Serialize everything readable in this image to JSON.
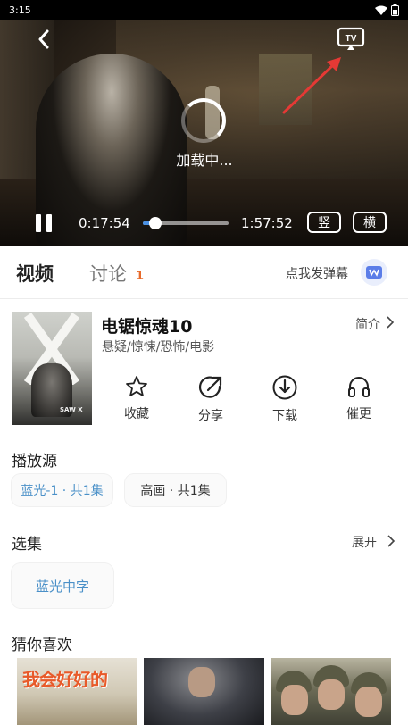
{
  "status_bar": {
    "time": "3:15"
  },
  "player": {
    "loading_text": "加载中...",
    "current_time": "0:17:54",
    "total_time": "1:57:52",
    "progress_fraction": 0.15,
    "portrait_button": "竖",
    "landscape_button": "横",
    "tv_icon_label": "TV"
  },
  "tabs": {
    "video_label": "视频",
    "discuss_label": "讨论",
    "discuss_count": "1",
    "danmu_label": "点我发弹幕"
  },
  "movie": {
    "title": "电锯惊魂10",
    "genres": "悬疑/惊悚/恐怖/电影",
    "intro_label": "简介",
    "poster_text": "SAW X"
  },
  "actions": [
    {
      "label": "收藏",
      "icon": "star-icon"
    },
    {
      "label": "分享",
      "icon": "share-icon"
    },
    {
      "label": "下载",
      "icon": "download-icon"
    },
    {
      "label": "催更",
      "icon": "headphones-icon"
    }
  ],
  "sources": {
    "title": "播放源",
    "items": [
      {
        "label": "蓝光-1 · 共1集",
        "active": true
      },
      {
        "label": "高画 · 共1集",
        "active": false
      }
    ]
  },
  "episodes": {
    "title": "选集",
    "expand_label": "展开",
    "items": [
      {
        "label": "蓝光中字"
      }
    ]
  },
  "recommend": {
    "title": "猜你喜欢",
    "first_card_text": "我会好好的"
  },
  "colors": {
    "accent_blue": "#4a90c8",
    "progress_blue": "#4a90e2",
    "badge_orange": "#e86a2a",
    "annotation_red": "#e53935"
  }
}
